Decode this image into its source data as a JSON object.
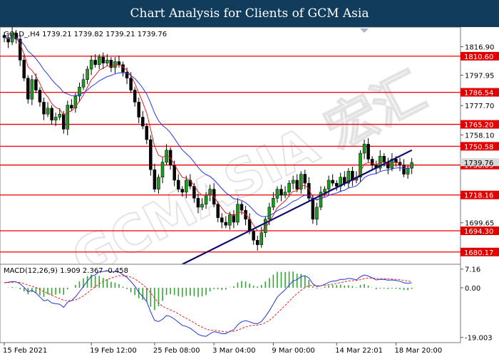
{
  "banner": {
    "title": "Chart Analysis for Clients of GCM Asia"
  },
  "chart_data": {
    "type": "line",
    "symbol": "GOLD_,H4",
    "ohlc_header": "1739.21 1739.82 1739.21 1739.76",
    "watermark": "GCMASIA 宏汇",
    "current_price_label": "1739.76",
    "price_axis": {
      "min": 1672,
      "max": 1830,
      "ticks": [
        1816.9,
        1797.95,
        1777.7,
        1758.1,
        1699.65
      ]
    },
    "levels": [
      {
        "label": "1810.60",
        "value": 1810.6
      },
      {
        "label": "1786.54",
        "value": 1786.54
      },
      {
        "label": "1765.20",
        "value": 1765.2
      },
      {
        "label": "1750.58",
        "value": 1750.58
      },
      {
        "label": "1738.09",
        "value": 1738.09
      },
      {
        "label": "1718.16",
        "value": 1718.16
      },
      {
        "label": "1694.30",
        "value": 1694.3
      },
      {
        "label": "1680.17",
        "value": 1680.17
      }
    ],
    "trendline": {
      "from": [
        45,
        1672
      ],
      "to": [
        103,
        1748
      ]
    },
    "x_labels": [
      {
        "label": "15 Feb 2021",
        "index": 0
      },
      {
        "label": "19 Feb 12:00",
        "index": 22
      },
      {
        "label": "25 Feb 08:00",
        "index": 38
      },
      {
        "label": "3 Mar 04:00",
        "index": 53
      },
      {
        "label": "9 Mar 00:00",
        "index": 68
      },
      {
        "label": "14 Mar 22:01",
        "index": 84
      },
      {
        "label": "18 Mar 20:00",
        "index": 99
      }
    ],
    "close": [
      1823,
      1820,
      1826,
      1822,
      1808,
      1796,
      1782,
      1795,
      1788,
      1780,
      1772,
      1776,
      1768,
      1770,
      1772,
      1762,
      1778,
      1776,
      1784,
      1790,
      1795,
      1802,
      1808,
      1805,
      1810,
      1806,
      1808,
      1803,
      1807,
      1805,
      1800,
      1796,
      1788,
      1780,
      1770,
      1764,
      1755,
      1735,
      1722,
      1730,
      1740,
      1748,
      1738,
      1728,
      1722,
      1720,
      1728,
      1724,
      1716,
      1710,
      1712,
      1718,
      1722,
      1712,
      1703,
      1700,
      1698,
      1705,
      1700,
      1712,
      1708,
      1702,
      1694,
      1688,
      1685,
      1693,
      1702,
      1710,
      1716,
      1722,
      1718,
      1720,
      1726,
      1728,
      1722,
      1732,
      1726,
      1716,
      1702,
      1710,
      1720,
      1722,
      1728,
      1726,
      1724,
      1730,
      1726,
      1734,
      1728,
      1730,
      1746,
      1752,
      1742,
      1738,
      1736,
      1744,
      1740,
      1736,
      1742,
      1740,
      1738,
      1732,
      1736,
      1739.76
    ],
    "macd": {
      "label": "MACD(12,26,9) 1.909 2.367 -0.458",
      "axis_ticks": [
        7.16,
        0.0,
        -19.003
      ],
      "min": -21,
      "max": 9,
      "macd_line": [
        2.0,
        2.1,
        2.4,
        2.3,
        1.5,
        0.2,
        -1.5,
        -1.0,
        -2.0,
        -3.5,
        -5.0,
        -4.6,
        -5.8,
        -6.1,
        -6.3,
        -7.5,
        -5.5,
        -4.9,
        -3.5,
        -1.5,
        0.5,
        2.5,
        4.4,
        5.0,
        6.1,
        6.2,
        6.5,
        6.0,
        6.2,
        6.0,
        5.0,
        4.0,
        2.4,
        0.6,
        -1.7,
        -3.4,
        -5.3,
        -9.2,
        -12.5,
        -12.9,
        -12.1,
        -10.6,
        -11.0,
        -12.0,
        -13.2,
        -14.4,
        -14.8,
        -15.5,
        -16.6,
        -17.8,
        -18.4,
        -18.6,
        -17.6,
        -16.8,
        -17.1,
        -17.6,
        -17.6,
        -16.7,
        -16.1,
        -14.2,
        -13.0,
        -12.6,
        -13.0,
        -13.6,
        -13.8,
        -12.9,
        -11.0,
        -8.8,
        -6.2,
        -3.6,
        -2.1,
        -0.7,
        1.0,
        2.6,
        3.1,
        4.3,
        4.6,
        3.8,
        1.5,
        0.5,
        0.7,
        1.3,
        2.1,
        2.5,
        2.7,
        3.2,
        3.2,
        3.6,
        3.4,
        3.0,
        4.2,
        4.9,
        4.5,
        3.8,
        3.0,
        3.2,
        3.2,
        2.9,
        3.0,
        2.8,
        2.5,
        1.9,
        1.7,
        1.909
      ],
      "signal_line": [
        2.0,
        2.0,
        2.1,
        2.2,
        2.0,
        1.6,
        1.0,
        0.6,
        0.1,
        -0.6,
        -1.5,
        -2.1,
        -2.9,
        -3.5,
        -4.1,
        -4.8,
        -4.9,
        -4.9,
        -4.6,
        -4.0,
        -3.1,
        -2.0,
        -0.7,
        0.4,
        1.5,
        2.4,
        3.2,
        3.7,
        4.2,
        4.6,
        4.6,
        4.5,
        4.1,
        3.4,
        2.3,
        1.2,
        -0.1,
        -1.9,
        -4.0,
        -5.8,
        -7.1,
        -7.8,
        -8.5,
        -9.2,
        -10.0,
        -10.9,
        -11.7,
        -12.5,
        -13.4,
        -14.3,
        -15.1,
        -15.8,
        -16.2,
        -16.3,
        -16.5,
        -16.7,
        -16.9,
        -16.8,
        -16.7,
        -16.2,
        -15.6,
        -15.0,
        -14.6,
        -14.4,
        -14.3,
        -14.0,
        -13.4,
        -12.5,
        -11.2,
        -9.7,
        -8.2,
        -6.7,
        -5.2,
        -3.6,
        -2.3,
        -1.0,
        0.1,
        0.8,
        0.9,
        0.8,
        0.8,
        0.9,
        1.2,
        1.4,
        1.7,
        2.0,
        2.3,
        2.6,
        2.7,
        2.8,
        3.1,
        3.5,
        3.7,
        3.7,
        3.6,
        3.5,
        3.5,
        3.4,
        3.3,
        3.2,
        3.1,
        2.8,
        2.6,
        2.367
      ]
    }
  }
}
